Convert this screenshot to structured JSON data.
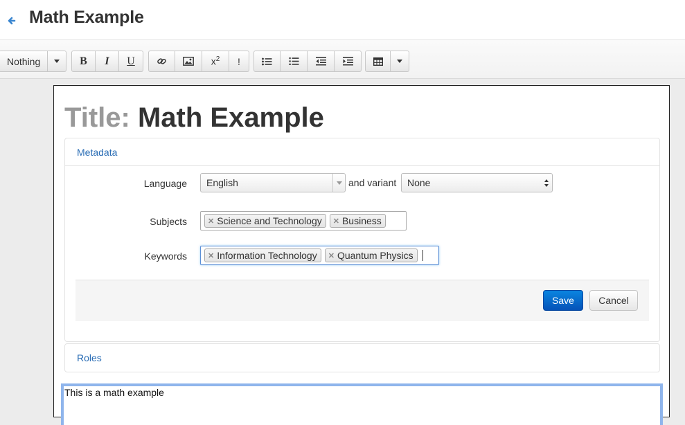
{
  "header": {
    "title": "Math Example",
    "back_icon": "arrow-left-icon"
  },
  "toolbar": {
    "style_select": "Nothing",
    "superscript_label": "x",
    "superscript_exp": "2",
    "exclaim_label": "!",
    "icons": [
      "bold-icon",
      "italic-icon",
      "underline-icon",
      "link-icon",
      "image-icon",
      "superscript-icon",
      "note-icon",
      "bullet-list-icon",
      "numbered-list-icon",
      "outdent-icon",
      "indent-icon",
      "table-icon"
    ]
  },
  "document": {
    "title_label": "Title:",
    "title_value": "Math Example",
    "metadata": {
      "heading": "Metadata",
      "language_label": "Language",
      "language_value": "English",
      "variant_label": "and variant",
      "variant_value": "None",
      "subjects_label": "Subjects",
      "subjects": [
        "Science and Technology",
        "Business"
      ],
      "keywords_label": "Keywords",
      "keywords": [
        "Information Technology",
        "Quantum Physics"
      ],
      "save_label": "Save",
      "cancel_label": "Cancel"
    },
    "roles_heading": "Roles",
    "body_text": "This is a math example"
  },
  "colors": {
    "link": "#2a6db5",
    "primary_button": "#0a6fd6",
    "focus": "#8fb5ec"
  }
}
